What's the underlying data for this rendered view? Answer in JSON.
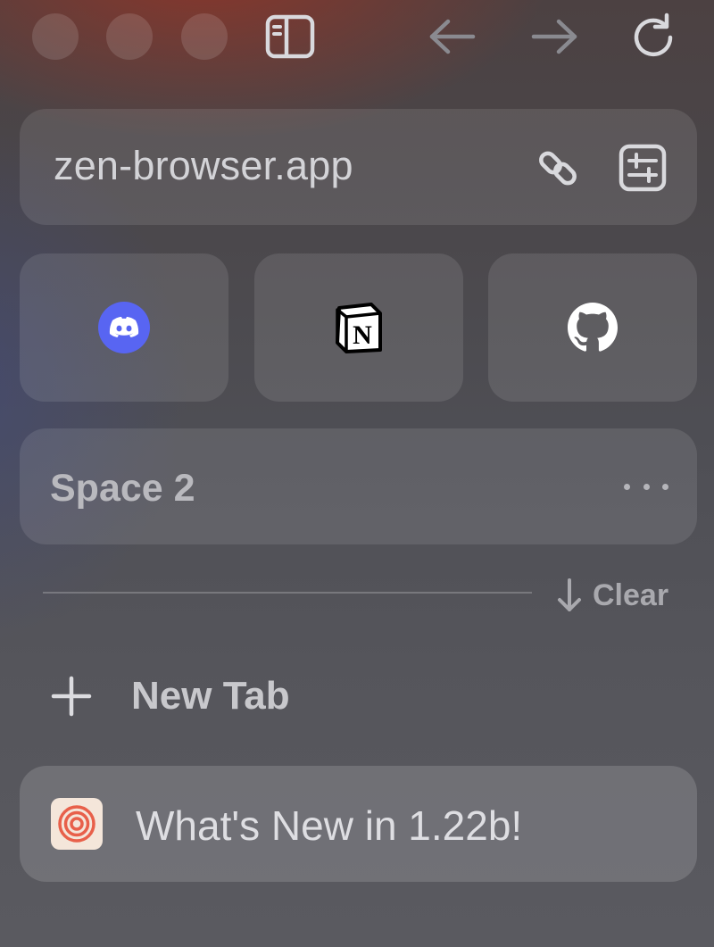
{
  "window": {
    "traffic_lights": [
      "close",
      "minimize",
      "zoom"
    ]
  },
  "toolbar": {
    "icons": {
      "sidebar": "sidebar-toggle-icon",
      "back": "arrow-left-icon",
      "forward": "arrow-right-icon",
      "reload": "reload-icon"
    }
  },
  "url_bar": {
    "text": "zen-browser.app",
    "icons": [
      "link-icon",
      "page-settings-icon"
    ]
  },
  "pinned": [
    {
      "site": "Discord",
      "icon": "discord-icon",
      "color": "#5865F2"
    },
    {
      "site": "Notion",
      "icon": "notion-icon",
      "color": "#000000"
    },
    {
      "site": "GitHub",
      "icon": "github-icon",
      "color": "#FFFFFF"
    }
  ],
  "space": {
    "title": "Space 2",
    "menu_icon": "more-dots-icon"
  },
  "separator": {
    "clear_label": "Clear"
  },
  "new_tab": {
    "label": "New Tab"
  },
  "tabs": [
    {
      "title": "What's New in 1.22b!",
      "favicon": "zen-logo-icon",
      "favicon_color": "#E8604A"
    }
  ]
}
